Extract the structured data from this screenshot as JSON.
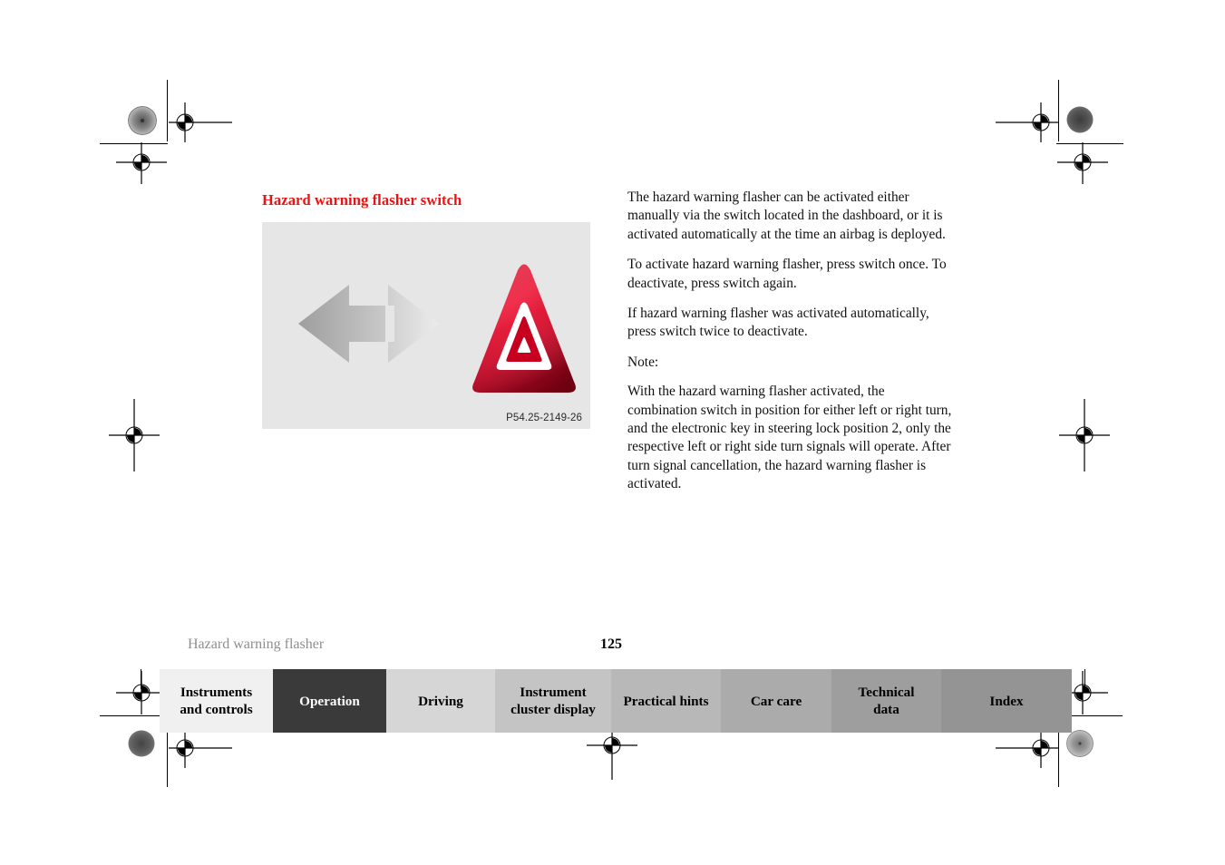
{
  "document": {
    "type": "owner-manual-page",
    "section_heading": "Hazard warning flasher switch",
    "heading_color": "#ee1111"
  },
  "figure": {
    "caption_id": "P54.25-2149-26",
    "background_color": "#e6e6e6",
    "button_color": "#c8102e",
    "arrow_color": "#b3b3b3",
    "description": "Hazard warning flasher switch with left and right arrows and red triangle button"
  },
  "body": {
    "paragraphs": [
      "The hazard warning flasher can be activated either manually via the switch located in the dashboard, or it is activated automatically at the time an airbag is deployed.",
      "To activate hazard warning flasher, press switch once. To deactivate, press switch again.",
      "If hazard warning flasher was activated automatically, press switch twice to deactivate.",
      "Note:",
      "With the hazard warning flasher activated, the combination switch in position for either left or right turn, and the electronic key in steering lock position 2, only the respective left or right side turn signals will operate. After turn signal cancellation, the hazard warning flasher is activated."
    ]
  },
  "footer": {
    "running_title": "Hazard warning flasher",
    "page_number": "125"
  },
  "tabs": [
    {
      "label": "Instruments and controls",
      "lines": [
        "Instruments",
        "and controls"
      ],
      "bg": "#f0f0f0",
      "fg": "#000000",
      "active": false
    },
    {
      "label": "Operation",
      "lines": [
        "Operation"
      ],
      "bg": "#3a3a3a",
      "fg": "#ffffff",
      "active": true
    },
    {
      "label": "Driving",
      "lines": [
        "Driving"
      ],
      "bg": "#d6d6d6",
      "fg": "#000000",
      "active": false
    },
    {
      "label": "Instrument cluster display",
      "lines": [
        "Instrument",
        "cluster display"
      ],
      "bg": "#c4c4c4",
      "fg": "#000000",
      "active": false
    },
    {
      "label": "Practical hints",
      "lines": [
        "Practical hints"
      ],
      "bg": "#b8b8b8",
      "fg": "#000000",
      "active": false
    },
    {
      "label": "Car care",
      "lines": [
        "Car care"
      ],
      "bg": "#ababab",
      "fg": "#000000",
      "active": false
    },
    {
      "label": "Technical data",
      "lines": [
        "Technical",
        "data"
      ],
      "bg": "#9e9e9e",
      "fg": "#000000",
      "active": false
    },
    {
      "label": "Index",
      "lines": [
        "Index"
      ],
      "bg": "#949494",
      "fg": "#000000",
      "active": false
    }
  ]
}
